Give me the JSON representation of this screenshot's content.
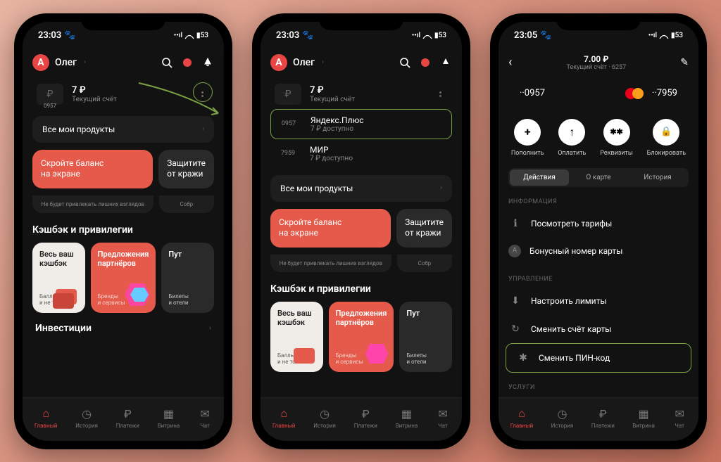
{
  "status": {
    "time1": "23:03",
    "time2": "23:03",
    "time3": "23:05",
    "paw": "🐾",
    "battery": "53"
  },
  "header": {
    "logo_letter": "А",
    "username": "Олег"
  },
  "balance": {
    "amount": "7 ₽",
    "subtitle": "Текущий счёт",
    "acct": "0957"
  },
  "cards_list": [
    {
      "num": "0957",
      "name": "Яндекс.Плюс",
      "avail": "7 ₽ доступно"
    },
    {
      "num": "7959",
      "name": "МИР",
      "avail": "7 ₽ доступно"
    }
  ],
  "all_products": "Все мои продукты",
  "banner1": {
    "line1": "Скройте баланс",
    "line2": "на экране",
    "foot": "Не будет привлекать лишних взглядов"
  },
  "banner2": {
    "line1": "Защитите",
    "line2": "от кражи",
    "foot": "Собр"
  },
  "cashback_title": "Кэшбэк и привилегии",
  "cashcards": [
    {
      "title": "Весь ваш\nкэшбэк",
      "sub": "Баллы, мили\nи не только"
    },
    {
      "title": "Предложения\nпартнёров",
      "sub": "Бренды\nи сервисы"
    },
    {
      "title": "Пут",
      "sub": "Билеты\nи отели"
    }
  ],
  "invest": "Инвестиции",
  "tabs": [
    {
      "label": "Главный",
      "active": true
    },
    {
      "label": "История",
      "active": false
    },
    {
      "label": "Платежи",
      "active": false
    },
    {
      "label": "Витрина",
      "active": false
    },
    {
      "label": "Чат",
      "active": false
    }
  ],
  "s3": {
    "amount": "7.00 ₽",
    "sub": "Текущий счёт · 6257",
    "cnum1": "··0957",
    "cnum2": "··7959",
    "actions": [
      {
        "icon": "+",
        "label": "Пополнить"
      },
      {
        "icon": "↑",
        "label": "Оплатить"
      },
      {
        "icon": "✱✱",
        "label": "Реквизиты"
      },
      {
        "icon": "🔒",
        "label": "Блокировать"
      }
    ],
    "segs": [
      "Действия",
      "О карте",
      "История"
    ],
    "grp1": "ИНФОРМАЦИЯ",
    "rows1": [
      {
        "icon": "ℹ",
        "label": "Посмотреть тарифы"
      },
      {
        "icon": "А",
        "label": "Бонусный номер карты"
      }
    ],
    "grp2": "УПРАВЛЕНИЕ",
    "rows2": [
      {
        "icon": "⬇",
        "label": "Настроить лимиты"
      },
      {
        "icon": "↻",
        "label": "Сменить счёт карты"
      },
      {
        "icon": "✱",
        "label": "Сменить ПИН-код"
      }
    ],
    "grp3": "УСЛУГИ"
  }
}
